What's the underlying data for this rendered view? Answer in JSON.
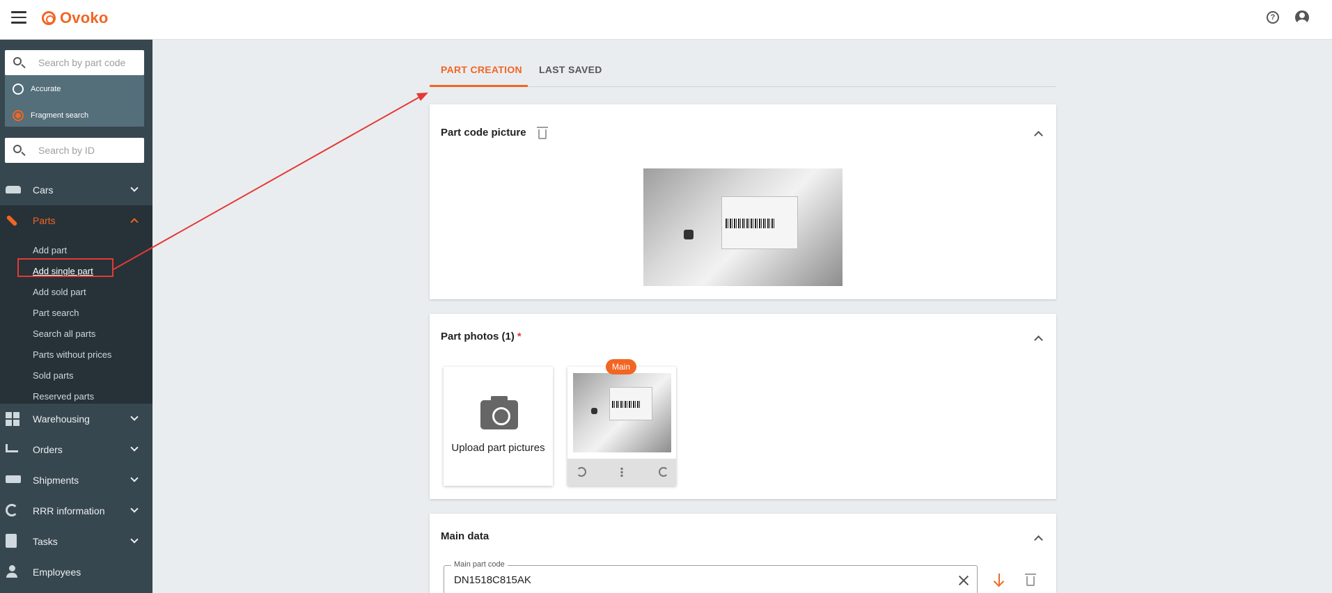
{
  "app": {
    "name": "Ovoko"
  },
  "colors": {
    "accent": "#f26522",
    "sidebar": "#37474f",
    "annotation": "#e53935"
  },
  "search": {
    "part_code_placeholder": "Search by part code",
    "modes": [
      {
        "label": "Accurate",
        "selected": false
      },
      {
        "label": "Fragment search",
        "selected": true
      }
    ],
    "id_placeholder": "Search by ID"
  },
  "sidebar": {
    "items": [
      {
        "label": "Cars",
        "icon": "car-icon"
      },
      {
        "label": "Parts",
        "icon": "wrench-icon",
        "expanded": true
      },
      {
        "label": "Warehousing",
        "icon": "warehouse-icon"
      },
      {
        "label": "Orders",
        "icon": "cart-icon"
      },
      {
        "label": "Shipments",
        "icon": "truck-icon"
      },
      {
        "label": "RRR information",
        "icon": "sync-icon"
      },
      {
        "label": "Tasks",
        "icon": "task-icon"
      },
      {
        "label": "Employees",
        "icon": "employee-icon"
      }
    ],
    "parts_sub": [
      "Add part",
      "Add single part",
      "Part search",
      "Search all parts",
      "Parts without prices",
      "Sold parts",
      "Reserved parts"
    ],
    "parts_sub_sold": "Add sold part"
  },
  "tabs": [
    "PART CREATION",
    "LAST SAVED"
  ],
  "cards": {
    "code_picture": {
      "title": "Part code picture"
    },
    "photos": {
      "title": "Part photos (1)",
      "required_mark": "*",
      "upload_label": "Upload part pictures",
      "main_badge": "Main"
    },
    "main_data": {
      "title": "Main data",
      "field_label": "Main part code",
      "field_value": "DN1518C815AK"
    }
  }
}
